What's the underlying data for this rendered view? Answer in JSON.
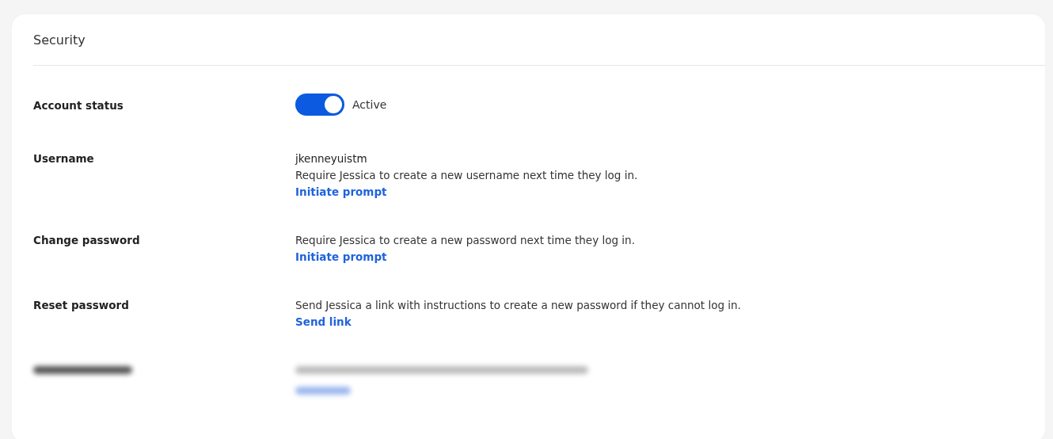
{
  "card": {
    "title": "Security"
  },
  "rows": [
    {
      "kind": "toggle",
      "label": "Account status",
      "on": true,
      "state_label": "Active"
    },
    {
      "kind": "prompt",
      "label": "Username",
      "value": "jkenneyuistm",
      "description": "Require Jessica to create a new username next time they log in.",
      "link": "Initiate prompt"
    },
    {
      "kind": "prompt",
      "label": "Change password",
      "description": "Require Jessica to create a new password next time they log in.",
      "link": "Initiate prompt"
    },
    {
      "kind": "prompt",
      "label": "Reset password",
      "description": "Send Jessica a link with instructions to create a new password if they cannot log in.",
      "link": "Send link"
    },
    {
      "kind": "redacted"
    }
  ]
}
